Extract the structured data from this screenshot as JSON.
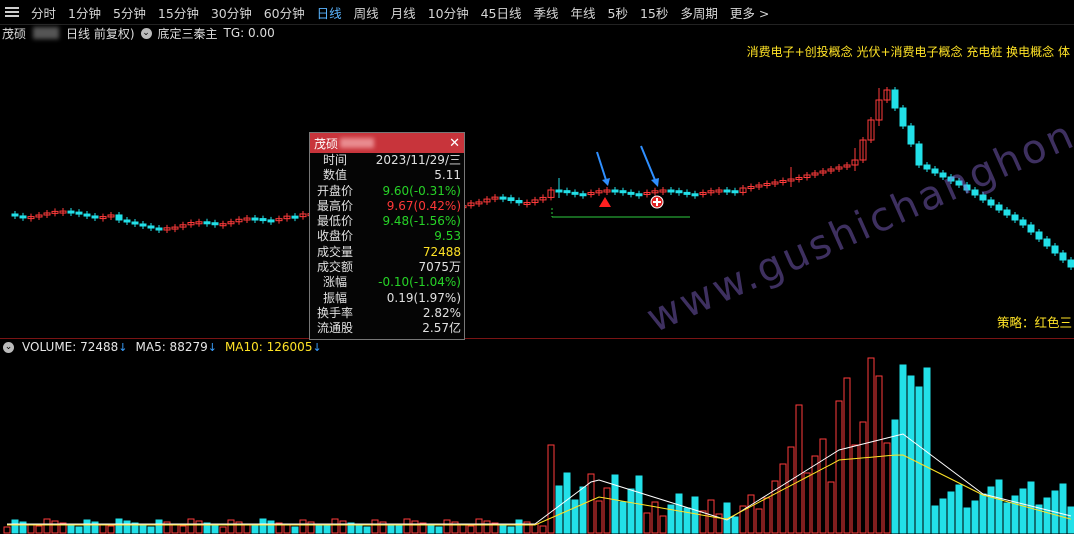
{
  "toolbar": {
    "tabs": [
      "分时",
      "1分钟",
      "5分钟",
      "15分钟",
      "30分钟",
      "60分钟",
      "日线",
      "周线",
      "月线",
      "10分钟",
      "45日线",
      "季线",
      "年线",
      "5秒",
      "15秒",
      "多周期",
      "更多 >"
    ],
    "active_tab": "日线"
  },
  "info": {
    "stock_name": "茂硕",
    "period": "日线 前复权)",
    "indicator": "底定三秦主",
    "tg": "TG: 0.00"
  },
  "concepts": "消费电子+创投概念 光伏+消费电子概念 充电桩 换电概念 体",
  "strategy": "策略：红色三",
  "popup": {
    "title": "茂硕",
    "rows": [
      {
        "k": "时间",
        "v": "2023/11/29/三",
        "c": ""
      },
      {
        "k": "数值",
        "v": "5.11",
        "c": ""
      },
      {
        "k": "开盘价",
        "v": "9.60(-0.31%)",
        "c": "green"
      },
      {
        "k": "最高价",
        "v": "9.67(0.42%)",
        "c": "red"
      },
      {
        "k": "最低价",
        "v": "9.48(-1.56%)",
        "c": "green"
      },
      {
        "k": "收盘价",
        "v": "9.53",
        "c": "green"
      },
      {
        "k": "成交量",
        "v": "72488",
        "c": "yellow"
      },
      {
        "k": "成交额",
        "v": "7075万",
        "c": ""
      },
      {
        "k": "涨幅",
        "v": "-0.10(-1.04%)",
        "c": "green"
      },
      {
        "k": "振幅",
        "v": "0.19(1.97%)",
        "c": ""
      },
      {
        "k": "换手率",
        "v": "2.82%",
        "c": ""
      },
      {
        "k": "流通股",
        "v": "2.57亿",
        "c": ""
      }
    ]
  },
  "volume": {
    "label": "VOLUME: 72488",
    "ma5": "MA5: 88279",
    "ma10": "MA10: 126005"
  },
  "watermark": "www.gushichanghong.com",
  "colors": {
    "up": "#ff3b3b",
    "down": "#22e0e8",
    "ma5": "#ffffff",
    "ma10": "#ffe326",
    "accent": "#5ab4ff"
  }
}
